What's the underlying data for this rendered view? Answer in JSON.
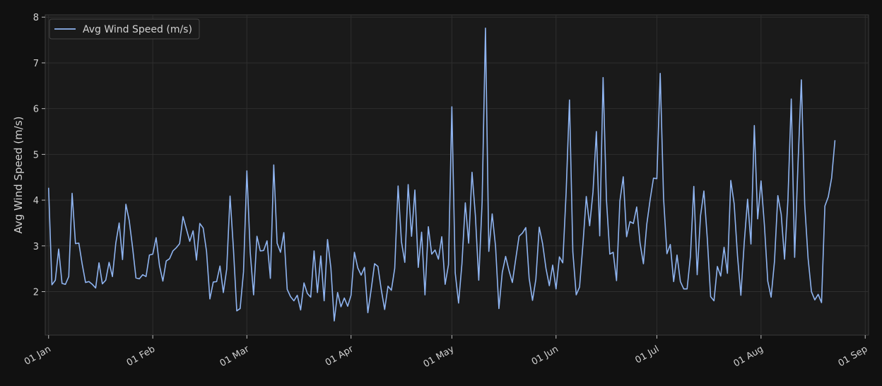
{
  "chart_data": {
    "type": "line",
    "title": "",
    "xlabel": "",
    "ylabel": "Avg Wind Speed (m/s)",
    "x_start": "01 Jan",
    "x_step_days": 1,
    "xlim": [
      "31 Dec",
      "02 Sep"
    ],
    "ylim": [
      1.05,
      8.05
    ],
    "yticks": [
      2,
      3,
      4,
      5,
      6,
      7,
      8
    ],
    "xtick_labels": [
      "01 Jan",
      "01 Feb",
      "01 Mar",
      "01 Apr",
      "01 May",
      "01 Jun",
      "01 Jul",
      "01 Aug",
      "01 Sep"
    ],
    "grid": true,
    "legend_position": "top-left",
    "colors": {
      "background": "#111111",
      "plot_area": "#1a1a1a",
      "line": "#8fb4f0",
      "grid": "#2e2e2e",
      "text": "#d2d2d2"
    },
    "series": [
      {
        "name": "Avg Wind Speed (m/s)",
        "values": [
          4.27,
          2.15,
          2.25,
          2.93,
          2.18,
          2.16,
          2.33,
          4.15,
          3.05,
          3.06,
          2.6,
          2.2,
          2.22,
          2.16,
          2.08,
          2.63,
          2.17,
          2.25,
          2.64,
          2.33,
          3.06,
          3.5,
          2.7,
          3.91,
          3.55,
          2.96,
          2.3,
          2.28,
          2.37,
          2.33,
          2.8,
          2.82,
          3.18,
          2.57,
          2.23,
          2.67,
          2.72,
          2.89,
          2.96,
          3.05,
          3.64,
          3.37,
          3.1,
          3.33,
          2.69,
          3.49,
          3.39,
          2.88,
          1.84,
          2.21,
          2.22,
          2.56,
          1.98,
          2.49,
          4.09,
          2.94,
          1.58,
          1.63,
          2.43,
          4.64,
          2.86,
          1.93,
          3.21,
          2.89,
          2.9,
          3.11,
          2.29,
          4.77,
          3.06,
          2.86,
          3.29,
          2.05,
          1.89,
          1.8,
          1.92,
          1.6,
          2.19,
          1.96,
          1.88,
          2.89,
          1.98,
          2.78,
          1.8,
          3.14,
          2.52,
          1.36,
          1.98,
          1.67,
          1.86,
          1.68,
          1.92,
          2.86,
          2.52,
          2.36,
          2.53,
          1.54,
          2.05,
          2.61,
          2.55,
          2.04,
          1.61,
          2.12,
          2.03,
          2.51,
          4.31,
          3.09,
          2.64,
          4.34,
          3.21,
          4.22,
          2.53,
          3.3,
          1.93,
          3.42,
          2.82,
          2.91,
          2.71,
          3.2,
          2.16,
          2.59,
          6.04,
          2.41,
          1.75,
          2.61,
          3.94,
          3.06,
          4.61,
          3.66,
          2.25,
          3.95,
          7.76,
          2.88,
          3.7,
          2.99,
          1.63,
          2.42,
          2.77,
          2.46,
          2.2,
          2.71,
          3.21,
          3.28,
          3.4,
          2.29,
          1.81,
          2.27,
          3.41,
          3.05,
          2.51,
          2.13,
          2.58,
          2.06,
          2.76,
          2.63,
          4.16,
          6.19,
          2.87,
          1.93,
          2.1,
          3.03,
          4.08,
          3.44,
          4.18,
          5.5,
          3.22,
          6.68,
          4.01,
          2.82,
          2.86,
          2.24,
          3.98,
          4.51,
          3.2,
          3.53,
          3.49,
          3.85,
          3.06,
          2.61,
          3.47,
          4.01,
          4.48,
          4.47,
          6.77,
          4.04,
          2.83,
          3.03,
          2.22,
          2.8,
          2.22,
          2.06,
          2.06,
          2.78,
          4.3,
          2.37,
          3.66,
          4.2,
          3.17,
          1.89,
          1.8,
          2.55,
          2.34,
          2.97,
          2.4,
          4.43,
          3.92,
          2.78,
          1.92,
          3.07,
          4.02,
          3.04,
          5.63,
          3.59,
          4.42,
          3.46,
          2.23,
          1.88,
          2.66,
          4.1,
          3.69,
          2.71,
          4.0,
          6.21,
          2.75,
          4.79,
          6.63,
          3.9,
          2.73,
          2.0,
          1.82,
          1.94,
          1.76,
          3.87,
          4.07,
          4.48,
          5.31
        ]
      }
    ]
  }
}
